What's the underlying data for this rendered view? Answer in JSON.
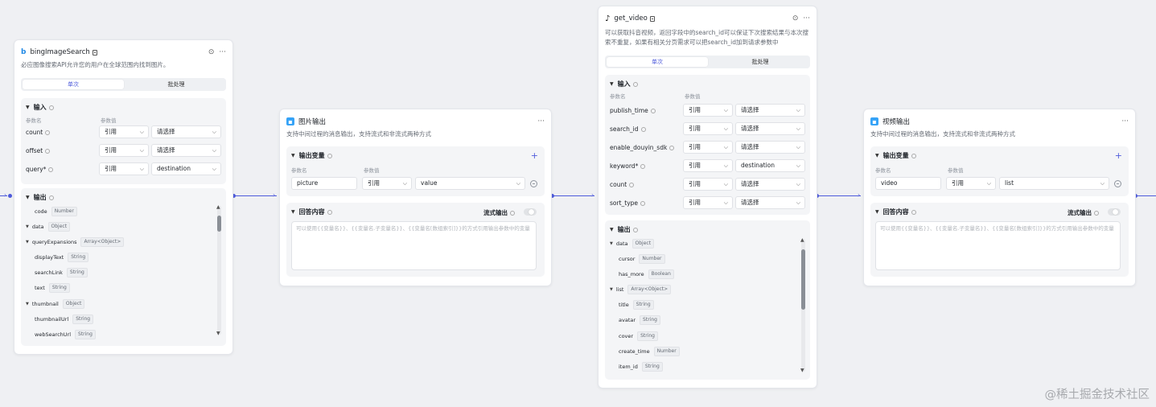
{
  "common": {
    "col_param": "参数名",
    "col_value": "参数值",
    "ref": "引用",
    "choose": "请选择"
  },
  "bing": {
    "title": "bingImageSearch",
    "desc": "必应图像搜索API允许您的用户在全球范围内找到图片。",
    "tab_single": "单次",
    "tab_batch": "批处理",
    "input_title": "输入",
    "inputs": [
      {
        "name": "count",
        "ref": "引用",
        "value": "请选择"
      },
      {
        "name": "offset",
        "ref": "引用",
        "value": "请选择"
      },
      {
        "name": "query*",
        "ref": "引用",
        "value": "destination"
      }
    ],
    "output_title": "输出",
    "outputs": [
      {
        "name": "code",
        "type": "Number"
      },
      {
        "name": "data",
        "type": "Object"
      },
      {
        "name": "queryExpansions",
        "type": "Array<Object>"
      },
      {
        "name": "displayText",
        "type": "String"
      },
      {
        "name": "searchLink",
        "type": "String"
      },
      {
        "name": "text",
        "type": "String"
      },
      {
        "name": "thumbnail",
        "type": "Object"
      },
      {
        "name": "thumbnailUrl",
        "type": "String"
      },
      {
        "name": "webSearchUrl",
        "type": "String"
      }
    ]
  },
  "img_out": {
    "title": "图片输出",
    "desc": "支持中间过程的消息输出，支持流式和非流式两种方式",
    "var_title": "输出变量",
    "param_name": "picture",
    "param_ref": "引用",
    "param_value": "value",
    "content_title": "回答内容",
    "stream_label": "流式输出",
    "placeholder": "可以使用{{变量名}}、{{变量名.子变量名}}、{{变量名[数组索引]}}的方式引用输出参数中的变量"
  },
  "video": {
    "title": "get_video",
    "desc": "可以获取抖音视频，返回字段中的search_id可以保证下次搜索结果与本次搜索不重复，如果有相关分页需求可以把search_id加到请求参数中",
    "tab_single": "单次",
    "tab_batch": "批处理",
    "input_title": "输入",
    "inputs": [
      {
        "name": "publish_time",
        "ref": "引用",
        "value": "请选择"
      },
      {
        "name": "search_id",
        "ref": "引用",
        "value": "请选择"
      },
      {
        "name": "enable_douyin_sdk",
        "ref": "引用",
        "value": "请选择"
      },
      {
        "name": "keyword*",
        "ref": "引用",
        "value": "destination"
      },
      {
        "name": "count",
        "ref": "引用",
        "value": "请选择"
      },
      {
        "name": "sort_type",
        "ref": "引用",
        "value": "请选择"
      }
    ],
    "output_title": "输出",
    "outputs": [
      {
        "name": "data",
        "type": "Object"
      },
      {
        "name": "cursor",
        "type": "Number"
      },
      {
        "name": "has_more",
        "type": "Boolean"
      },
      {
        "name": "list",
        "type": "Array<Object>"
      },
      {
        "name": "title",
        "type": "String"
      },
      {
        "name": "avatar",
        "type": "String"
      },
      {
        "name": "cover",
        "type": "String"
      },
      {
        "name": "create_time",
        "type": "Number"
      },
      {
        "name": "item_id",
        "type": "String"
      }
    ]
  },
  "vid_out": {
    "title": "视频输出",
    "desc": "支持中间过程的消息输出，支持流式和非流式两种方式",
    "var_title": "输出变量",
    "param_name": "video",
    "param_ref": "引用",
    "param_value": "list",
    "content_title": "回答内容",
    "stream_label": "流式输出",
    "placeholder": "可以使用{{变量名}}、{{变量名.子变量名}}、{{变量名[数组索引]}}的方式引用输出参数中的变量"
  },
  "watermark": "@稀土掘金技术社区",
  "accent": "#4e5bdb"
}
